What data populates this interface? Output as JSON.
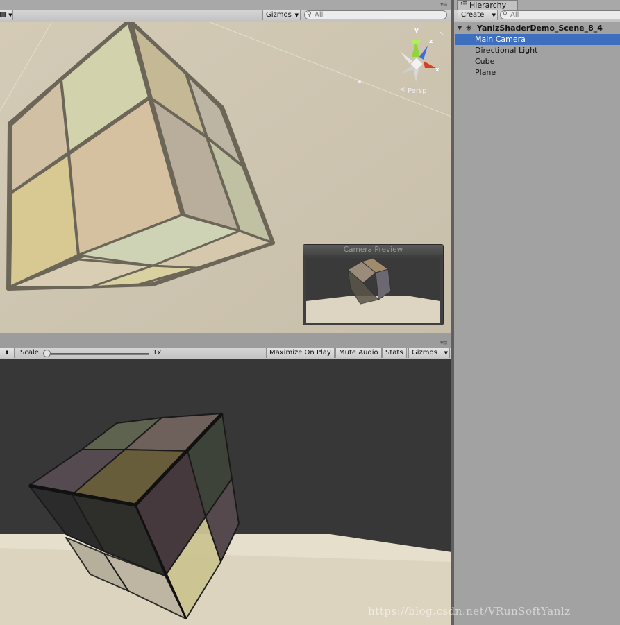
{
  "scene_view": {
    "toolbar": {
      "gizmos_label": "Gizmos",
      "search_placeholder": "All"
    },
    "gizmo": {
      "axis_y": "y",
      "axis_z": "z",
      "axis_x": "x",
      "projection_label": "Persp"
    },
    "camera_preview": {
      "title": "Camera Preview"
    }
  },
  "hierarchy": {
    "tab_label": "Hierarchy",
    "create_label": "Create",
    "search_placeholder": "All",
    "scene_name": "YanlzShaderDemo_Scene_8_4",
    "items": [
      {
        "label": "Main Camera",
        "selected": true
      },
      {
        "label": "Directional Light",
        "selected": false
      },
      {
        "label": "Cube",
        "selected": false
      },
      {
        "label": "Plane",
        "selected": false
      }
    ]
  },
  "game_view": {
    "toolbar": {
      "scale_label": "Scale",
      "scale_value": "1x",
      "maximize_label": "Maximize On Play",
      "mute_label": "Mute Audio",
      "stats_label": "Stats",
      "gizmos_label": "Gizmos"
    }
  },
  "watermark": "https://blog.csdn.net/VRunSoftYanlz",
  "colors": {
    "selection": "#3e6fbf",
    "scene_background": "#cdc4b0",
    "game_background": "#373737",
    "game_floor": "#ddd4bf"
  }
}
